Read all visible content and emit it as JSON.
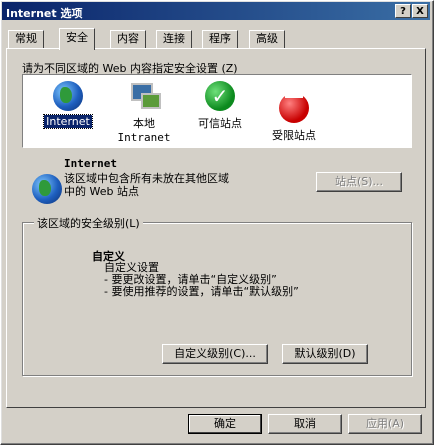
{
  "window": {
    "title": "Internet 选项",
    "help_label": "?",
    "close_label": "X"
  },
  "tabs": [
    {
      "label": "常规"
    },
    {
      "label": "安全"
    },
    {
      "label": "内容"
    },
    {
      "label": "连接"
    },
    {
      "label": "程序"
    },
    {
      "label": "高级"
    }
  ],
  "zones": {
    "prompt": "请为不同区域的 Web 内容指定安全设置 (Z)",
    "items": [
      {
        "label": "Internet",
        "icon": "globe-icon"
      },
      {
        "label": "本地",
        "sublabel": "Intranet",
        "icon": "local-intranet-icon"
      },
      {
        "label": "可信站点",
        "icon": "check-icon"
      },
      {
        "label": "受限站点",
        "icon": "restricted-icon"
      }
    ]
  },
  "info": {
    "title": "Internet",
    "line1": "该区域中包含所有未放在其他区域",
    "line2": "中的 Web 站点",
    "sites_button": "站点(S)..."
  },
  "security_level": {
    "group_label": "该区域的安全级别(L)",
    "level_name": "自定义",
    "line1": "自定义设置",
    "line2": "- 要更改设置，请单击“自定义级别”",
    "line3": "- 要使用推荐的设置，请单击“默认级别”",
    "custom_button": "自定义级别(C)...",
    "default_button": "默认级别(D)"
  },
  "footer": {
    "ok": "确定",
    "cancel": "取消",
    "apply": "应用(A)"
  }
}
